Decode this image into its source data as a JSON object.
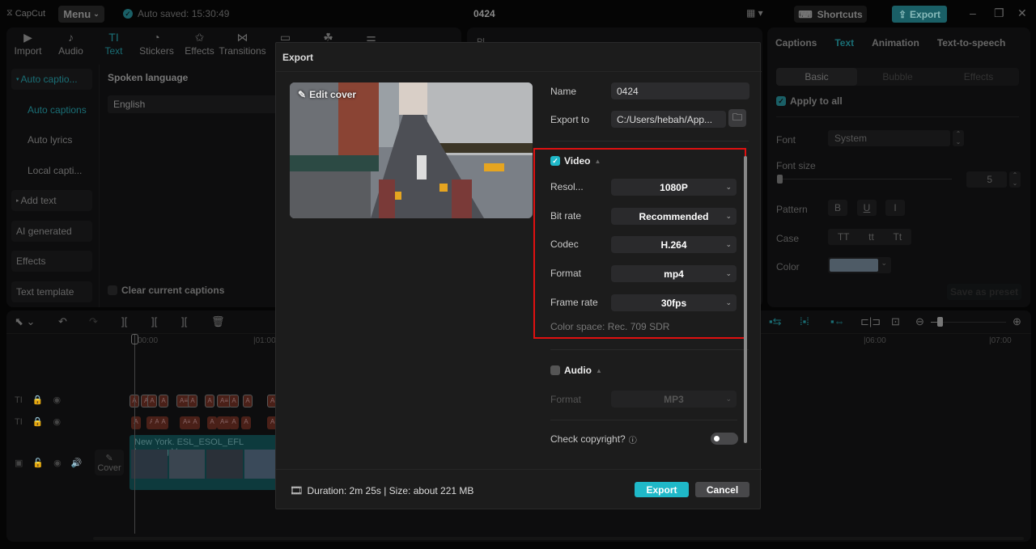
{
  "titlebar": {
    "app_name": "CapCut",
    "menu_label": "Menu",
    "autosave": "Auto saved: 15:30:49",
    "project_title": "0424",
    "shortcuts_label": "Shortcuts",
    "export_label": "Export"
  },
  "media_toolbar": [
    {
      "label": "Import",
      "icon": "import-icon"
    },
    {
      "label": "Audio",
      "icon": "audio-icon"
    },
    {
      "label": "Text",
      "icon": "text-icon",
      "active": true
    },
    {
      "label": "Stickers",
      "icon": "stickers-icon"
    },
    {
      "label": "Effects",
      "icon": "effects-icon"
    },
    {
      "label": "Transitions",
      "icon": "transitions-icon"
    },
    {
      "label": "",
      "icon": "captions-icon"
    },
    {
      "label": "",
      "icon": "filters-icon"
    },
    {
      "label": "",
      "icon": "adjust-icon"
    }
  ],
  "side_nav": {
    "items": [
      {
        "label": "Auto captio...",
        "expanded": true,
        "active": true
      },
      {
        "label": "Auto captions",
        "sub": true,
        "active": true
      },
      {
        "label": "Auto lyrics",
        "sub": true
      },
      {
        "label": "Local capti...",
        "sub": true
      },
      {
        "label": "Add text"
      },
      {
        "label": "AI generated"
      },
      {
        "label": "Effects"
      },
      {
        "label": "Text template"
      }
    ]
  },
  "captions_panel": {
    "spoken_language_label": "Spoken language",
    "language_value": "English",
    "clear_captions_label": "Clear current captions"
  },
  "player": {
    "label": "Pl..."
  },
  "right_panel": {
    "tabs": [
      "Captions",
      "Text",
      "Animation",
      "Text-to-speech"
    ],
    "active_tab": "Text",
    "subtabs": [
      "Basic",
      "Bubble",
      "Effects"
    ],
    "active_subtab": "Basic",
    "apply_to_all": "Apply to all",
    "font_label": "Font",
    "font_value": "System",
    "font_size_label": "Font size",
    "font_size_value": "5",
    "pattern_label": "Pattern",
    "pattern_buttons": [
      "B",
      "U",
      "I"
    ],
    "case_label": "Case",
    "case_buttons": [
      "TT",
      "tt",
      "Tt"
    ],
    "color_label": "Color",
    "color_value": "#4e5b66",
    "save_preset_label": "Save as preset"
  },
  "timeline": {
    "ruler": [
      "00:00",
      "01:00",
      "06:00",
      "07:00"
    ],
    "video_clip_title": "New York. ESL_ESOL_EFL Learning V",
    "cover_label": "Cover"
  },
  "export_dialog": {
    "title": "Export",
    "edit_cover_label": "Edit cover",
    "name_label": "Name",
    "name_value": "0424",
    "export_to_label": "Export to",
    "export_to_value": "C:/Users/hebah/App...",
    "video": {
      "section_label": "Video",
      "checked": true,
      "fields": [
        {
          "label": "Resol...",
          "value": "1080P"
        },
        {
          "label": "Bit rate",
          "value": "Recommended"
        },
        {
          "label": "Codec",
          "value": "H.264"
        },
        {
          "label": "Format",
          "value": "mp4"
        },
        {
          "label": "Frame rate",
          "value": "30fps"
        }
      ],
      "color_space": "Color space: Rec. 709 SDR"
    },
    "audio": {
      "section_label": "Audio",
      "checked": false,
      "format_label": "Format",
      "format_value": "MP3"
    },
    "check_copyright_label": "Check copyright?",
    "check_copyright_on": false,
    "footer_info": "Duration: 2m 25s | Size: about 221 MB",
    "export_button": "Export",
    "cancel_button": "Cancel"
  },
  "colors": {
    "accent": "#1fb8c8",
    "accent_dim": "#1a5f66",
    "highlight_box": "#e01010",
    "dialog_bg": "#1c1c1c"
  }
}
